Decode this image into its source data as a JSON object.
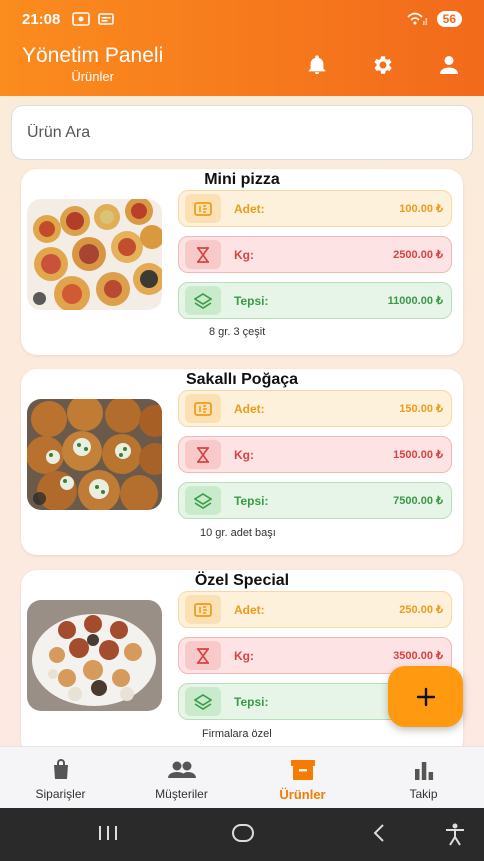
{
  "status": {
    "time": "21:08",
    "battery": "56"
  },
  "header": {
    "title": "Yönetim Paneli",
    "subtitle": "Ürünler"
  },
  "search": {
    "placeholder": "Ürün Ara"
  },
  "products": [
    {
      "name": "Mini pizza",
      "prices": {
        "adet_label": "Adet:",
        "adet": "100.00 ₺",
        "kg_label": "Kg:",
        "kg": "2500.00 ₺",
        "tepsi_label": "Tepsi:",
        "tepsi": "11000.00 ₺"
      },
      "note": "8 gr. 3 çeşit"
    },
    {
      "name": "Sakallı Poğaça",
      "prices": {
        "adet_label": "Adet:",
        "adet": "150.00 ₺",
        "kg_label": "Kg:",
        "kg": "1500.00 ₺",
        "tepsi_label": "Tepsi:",
        "tepsi": "7500.00 ₺"
      },
      "note": "10 gr. adet başı"
    },
    {
      "name": "Özel Special",
      "prices": {
        "adet_label": "Adet:",
        "adet": "250.00 ₺",
        "kg_label": "Kg:",
        "kg": "3500.00 ₺",
        "tepsi_label": "Tepsi:",
        "tepsi": ""
      },
      "note": "Firmalara özel"
    }
  ],
  "nav": [
    {
      "label": "Siparişler",
      "icon": "shopping-bag-icon"
    },
    {
      "label": "Müşteriler",
      "icon": "people-icon"
    },
    {
      "label": "Ürünler",
      "icon": "inventory-box-icon",
      "active": true
    },
    {
      "label": "Takip",
      "icon": "bar-chart-icon"
    }
  ],
  "colors": {
    "header": "#f57c1b",
    "accent": "#f57c00",
    "fab": "#ff9a10"
  }
}
